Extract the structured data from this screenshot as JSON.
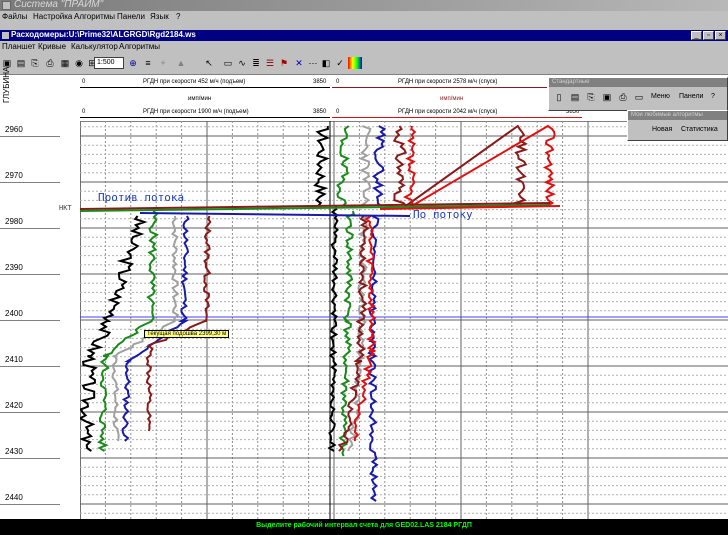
{
  "app": {
    "title": "Система \"ПРАЙМ\""
  },
  "main_menu": [
    "Файлы",
    "Настройка",
    "Алгоритмы",
    "Панели",
    "Язык",
    "?"
  ],
  "document": {
    "title": "Расходомеры:U:\\Prime32\\ALGRGD\\Rgd2184.ws"
  },
  "doc_menu": [
    "Планшет",
    "Кривые",
    "Калькулятор",
    "Алгоритмы"
  ],
  "toolbar": {
    "scale_value": "1:500",
    "zoom_icon": "zoom-icon"
  },
  "header": {
    "depth_axis_label": "ГЛУБИНА",
    "track1_top": {
      "min": "0",
      "max": "3850",
      "label": "РГДН при скорости 452 м/ч (подъем)"
    },
    "track1_unit": "имп/мин",
    "track1_bottom": {
      "min": "0",
      "max": "3850",
      "label": "РГДН при скорости 1900 м/ч (подъем)"
    },
    "track2_top": {
      "min": "0",
      "max": "3850",
      "label": "РГДН при скорости 2578 м/ч (спуск)"
    },
    "track2_unit": "имп/мин",
    "track2_bottom": {
      "min": "0",
      "max": "3850",
      "label": "РГДН при скорости 2042 м/ч (спуск)"
    }
  },
  "depth_ticks": [
    "2960",
    "2970",
    "2980",
    "2390",
    "2400",
    "2410",
    "2420",
    "2430",
    "2440"
  ],
  "annotations": {
    "against_flow": "Против потока",
    "with_flow": "По потоку",
    "nkt": "НКТ",
    "current_base": "Текущая подошва 2399,30 м"
  },
  "panels": {
    "standard": {
      "title": "Стандартные",
      "menu_label": "Меню",
      "panels_label": "Панели",
      "help_label": "?"
    },
    "custom_algorithms": {
      "title": "Мои любимые алгоритмы",
      "new_label": "Новая",
      "stats_label": "Статистика"
    }
  },
  "status": {
    "text": "Выделите рабочий интервал счета для  GED02.LAS 2184 РГДП"
  },
  "colors": {
    "accent": "#000080",
    "curve_black": "#000000",
    "curve_green": "#1a8a1a",
    "curve_gray": "#a0a0a0",
    "curve_blue": "#1a1aa8",
    "curve_darkred": "#8a1a1a",
    "curve_red": "#e01010"
  }
}
